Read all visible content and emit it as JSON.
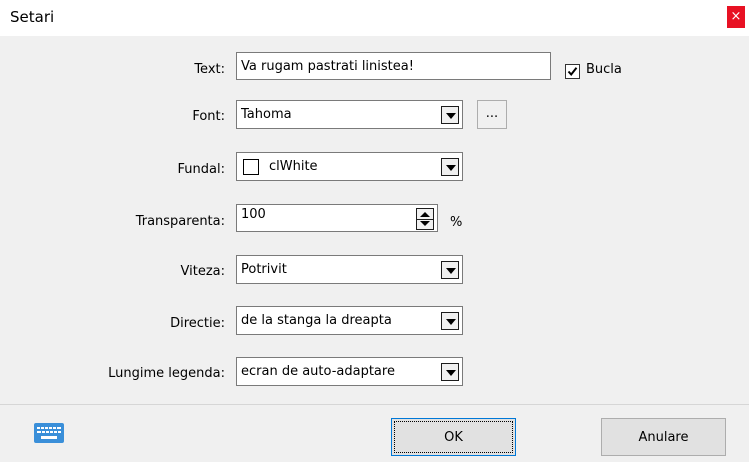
{
  "window": {
    "title": "Setari",
    "close_glyph": "×"
  },
  "form": {
    "text": {
      "label": "Text:",
      "value": "Va rugam pastrati linistea!"
    },
    "loop": {
      "label": "Bucla",
      "checked": true
    },
    "font": {
      "label": "Font:",
      "value": "Tahoma",
      "browse_label": "..."
    },
    "background": {
      "label": "Fundal:",
      "value": "clWhite",
      "swatch_color": "#ffffff"
    },
    "transparency": {
      "label": "Transparenta:",
      "value": "100",
      "unit": "%"
    },
    "speed": {
      "label": "Viteza:",
      "value": "Potrivit"
    },
    "direction": {
      "label": "Directie:",
      "value": "de la stanga la dreapta"
    },
    "legend_length": {
      "label": "Lungime legenda:",
      "value": "ecran de auto-adaptare"
    }
  },
  "footer": {
    "keyboard_icon": "keyboard-icon",
    "ok_label": "OK",
    "cancel_label": "Anulare"
  },
  "colors": {
    "close_button": "#e81123",
    "keyboard_icon": "#3a8fd9"
  }
}
